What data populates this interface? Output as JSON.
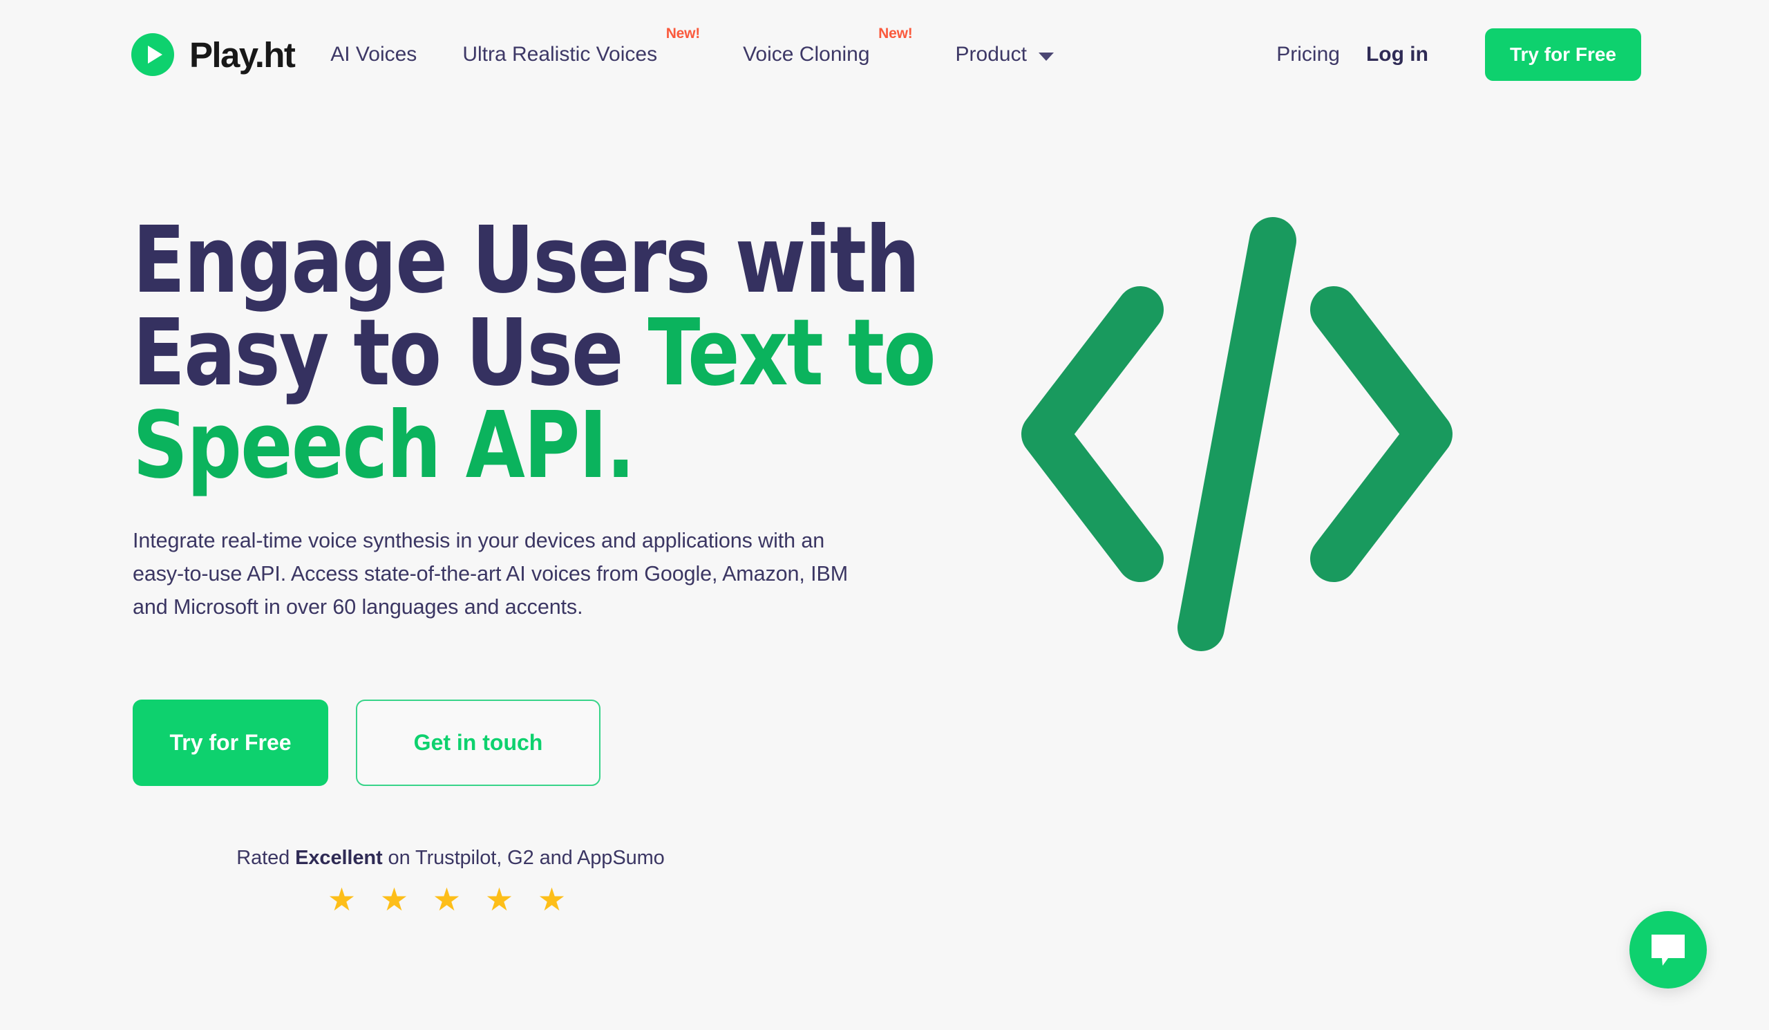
{
  "theme": {
    "page_background": "#f7f7f7",
    "brand_green": "#0ed16e",
    "headline_green": "#0bb35d",
    "art_green": "#199a5e",
    "navy": "#353160",
    "badge_orange": "#fa5a3d",
    "star_gold": "#fdbe19"
  },
  "header": {
    "brand": {
      "name": "Play.ht",
      "logo_icon": "play-circle-icon"
    },
    "nav": [
      {
        "label": "AI Voices",
        "badge": null
      },
      {
        "label": "Ultra Realistic Voices",
        "badge": "New!"
      },
      {
        "label": "Voice Cloning",
        "badge": "New!"
      },
      {
        "label": "Product",
        "badge": null,
        "has_dropdown": true,
        "dropdown_icon": "chevron-down-icon"
      }
    ],
    "pricing_label": "Pricing",
    "login_label": "Log in",
    "cta_label": "Try for Free"
  },
  "hero": {
    "headline": {
      "line1": "Engage Users with",
      "line2_dark": "Easy to Use ",
      "line2_green": "Text to",
      "line3_green": "Speech API."
    },
    "subtext": "Integrate real-time voice synthesis in your devices and applications with an easy-to-use API. Access state-of-the-art AI voices from Google, Amazon, IBM and Microsoft in over 60 languages and accents.",
    "primary_cta": "Try for Free",
    "secondary_cta": "Get in touch",
    "rating": {
      "prefix": "Rated ",
      "emphasis": "Excellent",
      "suffix": " on Trustpilot, G2 and AppSumo",
      "stars": "★ ★ ★ ★ ★",
      "star_count": 5
    },
    "art_icon": "code-brackets-icon"
  },
  "chat": {
    "launcher_icon": "chat-bubble-icon"
  }
}
